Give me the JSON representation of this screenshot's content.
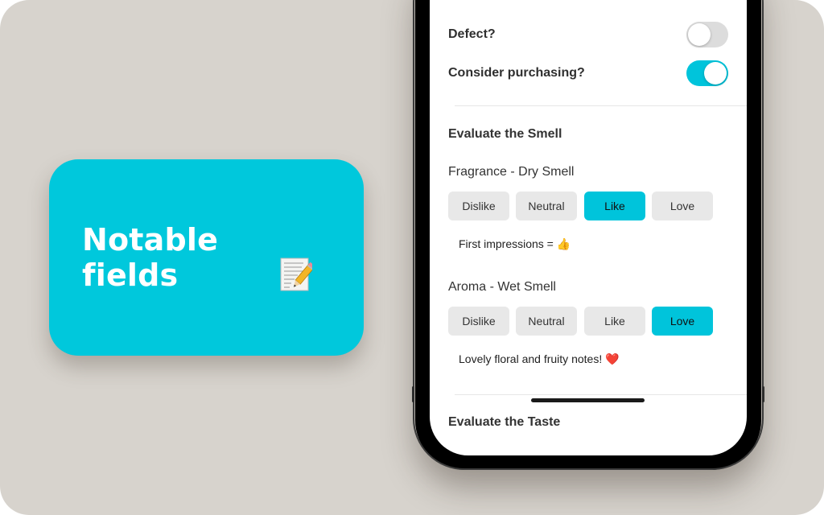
{
  "feature_card": {
    "title": "Notable\nfields",
    "icon": "memo-icon",
    "background_color": "#00c8dc"
  },
  "form": {
    "toggles": [
      {
        "label": "Defect?",
        "state": "off"
      },
      {
        "label": "Consider purchasing?",
        "state": "on"
      }
    ],
    "sections": [
      {
        "title": "Evaluate the Smell",
        "fields": [
          {
            "label": "Fragrance - Dry Smell",
            "options": [
              "Dislike",
              "Neutral",
              "Like",
              "Love"
            ],
            "selected": "Like",
            "note": "First impressions = 👍"
          },
          {
            "label": "Aroma - Wet Smell",
            "options": [
              "Dislike",
              "Neutral",
              "Like",
              "Love"
            ],
            "selected": "Love",
            "note": "Lovely floral and fruity notes! ❤️"
          }
        ]
      },
      {
        "title": "Evaluate the Taste",
        "fields": []
      }
    ],
    "accent_color": "#00c4db"
  }
}
